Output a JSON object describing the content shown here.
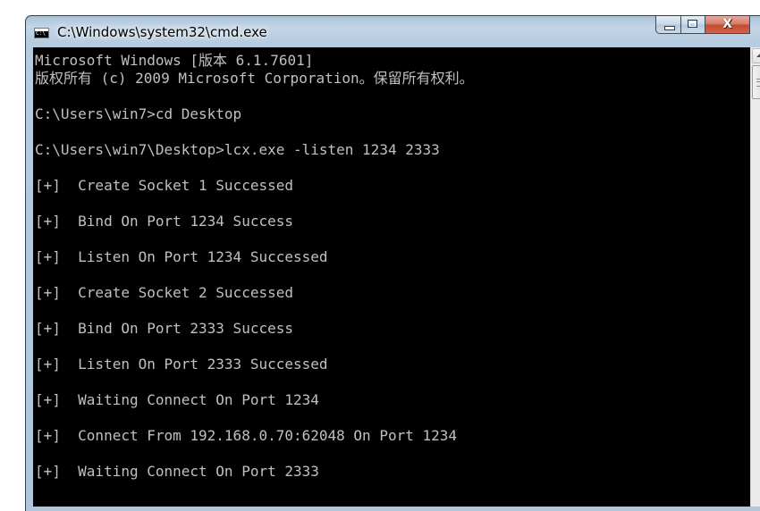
{
  "window": {
    "title": "C:\\Windows\\system32\\cmd.exe",
    "icon": "cmd-icon",
    "controls": {
      "minimize_icon": "minimize-icon",
      "maximize_icon": "maximize-icon",
      "close_icon": "close-icon",
      "close_glyph": "X"
    }
  },
  "console": {
    "foreground": "#c0c0c0",
    "background": "#000000",
    "lines": [
      "Microsoft Windows [版本 6.1.7601]",
      "版权所有 (c) 2009 Microsoft Corporation。保留所有权利。",
      "",
      "C:\\Users\\win7>cd Desktop",
      "",
      "C:\\Users\\win7\\Desktop>lcx.exe -listen 1234 2333",
      "",
      "[+]  Create Socket 1 Successed",
      "",
      "[+]  Bind On Port 1234 Success",
      "",
      "[+]  Listen On Port 1234 Successed",
      "",
      "[+]  Create Socket 2 Successed",
      "",
      "[+]  Bind On Port 2333 Success",
      "",
      "[+]  Listen On Port 2333 Successed",
      "",
      "[+]  Waiting Connect On Port 1234",
      "",
      "[+]  Connect From 192.168.0.70:62048 On Port 1234",
      "",
      "[+]  Waiting Connect On Port 2333",
      "",
      ""
    ]
  },
  "scrollbar": {
    "up_icon": "scroll-up-arrow-icon"
  }
}
